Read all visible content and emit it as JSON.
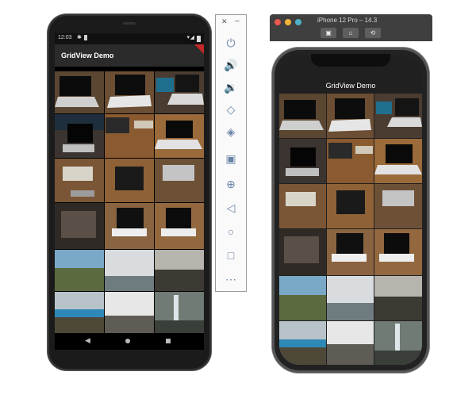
{
  "android": {
    "status_time": "12:03",
    "app_title": "GridView Demo"
  },
  "emulator_toolbar": {
    "buttons": [
      "close",
      "minimize",
      "power",
      "volume-up",
      "volume-down",
      "rotate-left",
      "rotate-right",
      "screenshot",
      "zoom",
      "back",
      "home",
      "overview",
      "more"
    ]
  },
  "ios_simulator": {
    "window_title": "iPhone 12 Pro – 14.3",
    "app_title": "GridView Demo"
  }
}
